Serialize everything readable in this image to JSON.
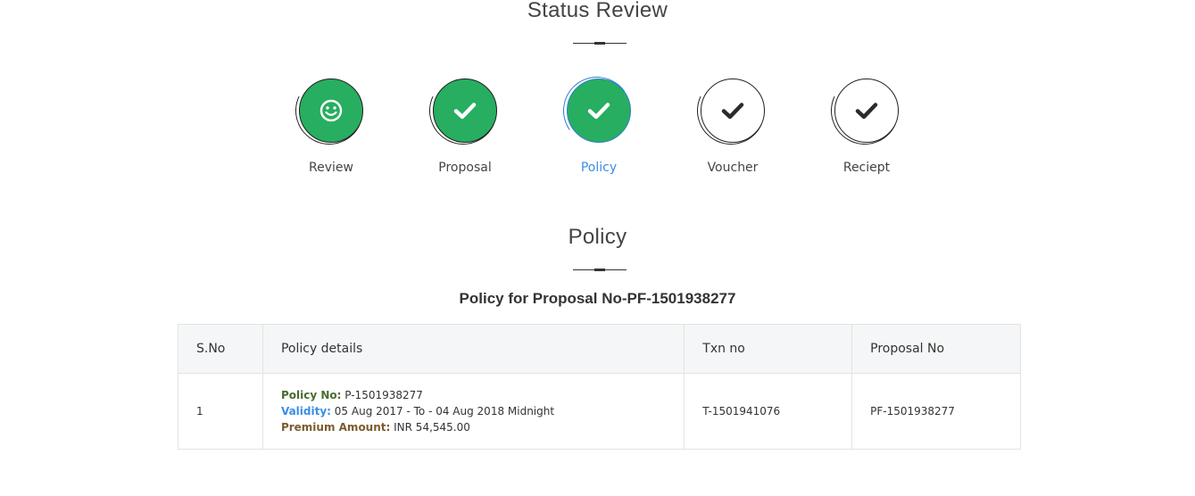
{
  "status_section": {
    "title": "Status Review"
  },
  "steps": [
    {
      "label": "Review",
      "icon": "smiley-icon",
      "state": "done"
    },
    {
      "label": "Proposal",
      "icon": "check-icon",
      "state": "done"
    },
    {
      "label": "Policy",
      "icon": "check-icon",
      "state": "active"
    },
    {
      "label": "Voucher",
      "icon": "check-icon",
      "state": "pending"
    },
    {
      "label": "Reciept",
      "icon": "check-icon",
      "state": "pending"
    }
  ],
  "policy_section": {
    "title": "Policy",
    "heading": "Policy for Proposal No-PF-1501938277"
  },
  "table": {
    "headers": [
      "S.No",
      "Policy details",
      "Txn no",
      "Proposal No"
    ],
    "rows": [
      {
        "sno": "1",
        "policy_no_label": "Policy No:",
        "policy_no": "P-1501938277",
        "validity_label": "Validity:",
        "validity": "05 Aug 2017 - To - 04 Aug 2018 Midnight",
        "premium_label": "Premium Amount:",
        "premium": "INR 54,545.00",
        "txn_no": "T-1501941076",
        "proposal_no": "PF-1501938277"
      }
    ]
  },
  "colors": {
    "done_fill": "#27ae60",
    "active_accent": "#3a8ee6",
    "policy_label": "#4a6b2e",
    "premium_label": "#7a5c2e"
  }
}
